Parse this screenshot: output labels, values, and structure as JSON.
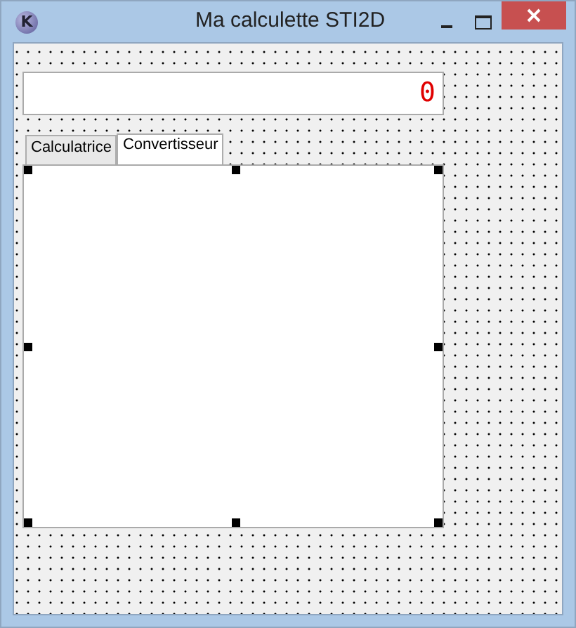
{
  "window": {
    "title": "Ma calculette STI2D",
    "icon_letter": "K"
  },
  "display": {
    "value": "0"
  },
  "tabs": [
    {
      "label": "Calculatrice",
      "selected": false
    },
    {
      "label": "Convertisseur",
      "selected": true
    }
  ]
}
